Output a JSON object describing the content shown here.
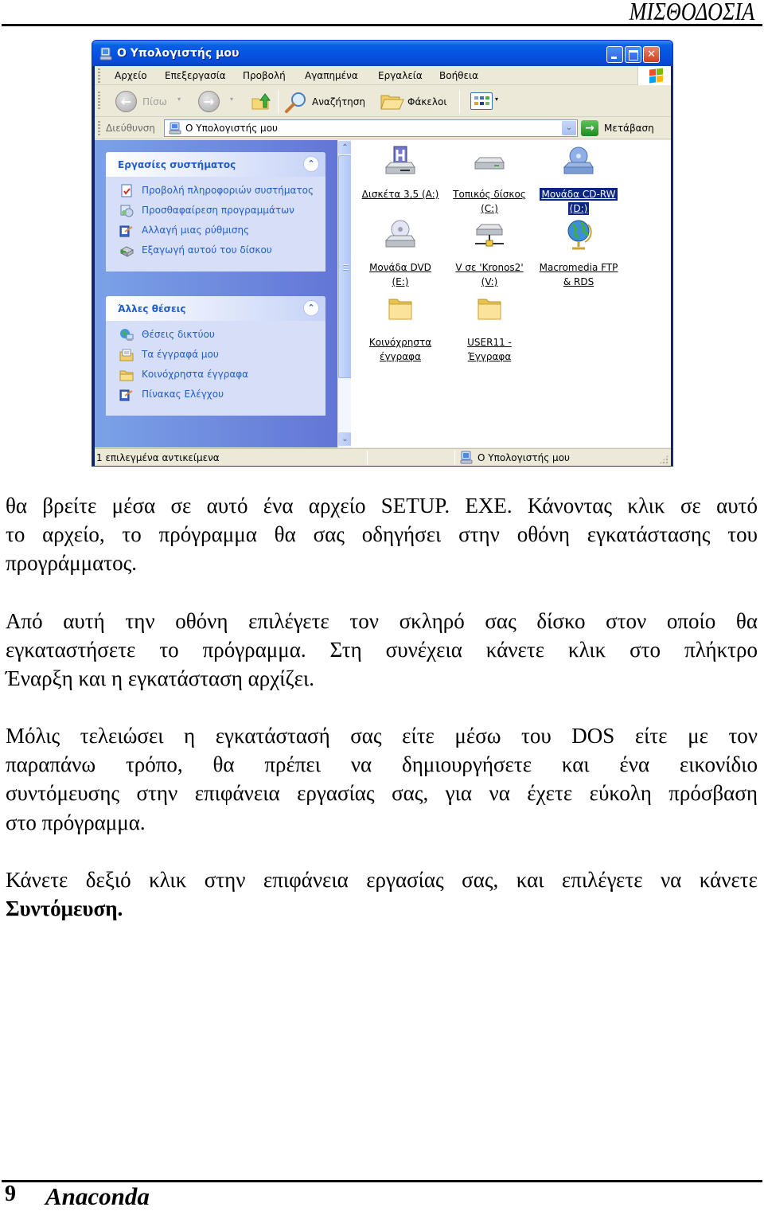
{
  "page_header": {
    "title": "ΜΙΣΘΟΔΟΣΙΑ"
  },
  "window": {
    "title": "Ο Υπολογιστής μου",
    "title_icon": "my-computer-icon",
    "controls": {
      "minimize": "minimize",
      "maximize": "maximize",
      "close": "✕"
    },
    "menu": [
      "Αρχείο",
      "Επεξεργασία",
      "Προβολή",
      "Αγαπημένα",
      "Εργαλεία",
      "Βοήθεια"
    ],
    "toolbar": {
      "back_label": "Πίσω",
      "search_label": "Αναζήτηση",
      "folders_label": "Φάκελοι",
      "back_arrow": "←",
      "forward_arrow": "→",
      "dropdown": "▾"
    },
    "address": {
      "label": "Διεύθυνση",
      "value": "Ο Υπολογιστής μου",
      "dropdown": "⌄",
      "go_arrow": "→",
      "go_label": "Μετάβαση"
    },
    "taskpane": {
      "system_tasks": {
        "title": "Εργασίες συστήματος",
        "collapse": "⌃",
        "items": [
          {
            "label": "Προβολή πληροφοριών συστήματος",
            "icon": "system-info-icon"
          },
          {
            "label": "Προσθαφαίρεση προγραμμάτων",
            "icon": "add-remove-programs-icon"
          },
          {
            "label": "Αλλαγή μιας ρύθμισης",
            "icon": "control-panel-icon"
          },
          {
            "label": "Εξαγωγή αυτού του δίσκου",
            "icon": "eject-disk-icon"
          }
        ]
      },
      "other_places": {
        "title": "Άλλες θέσεις",
        "collapse": "⌃",
        "items": [
          {
            "label": "Θέσεις δικτύου",
            "icon": "network-places-icon"
          },
          {
            "label": "Τα έγγραφά μου",
            "icon": "my-documents-icon"
          },
          {
            "label": "Κοινόχρηστα έγγραφα",
            "icon": "shared-documents-icon"
          },
          {
            "label": "Πίνακας Ελέγχου",
            "icon": "control-panel-icon"
          }
        ]
      }
    },
    "scrollbar": {
      "up": "⌃",
      "down": "⌄"
    },
    "items": [
      {
        "line1": "Δισκέτα 3,5 (A:)",
        "line2": "",
        "icon": "floppy-drive-icon",
        "selected": false
      },
      {
        "line1": "Τοπικός δίσκος",
        "line2": "(C:)",
        "icon": "hard-disk-icon",
        "selected": false
      },
      {
        "line1": "Μονάδα CD-RW",
        "line2": "(D:)",
        "icon": "cd-drive-icon",
        "selected": true
      },
      {
        "line1": "Μονάδα DVD",
        "line2": "(E:)",
        "icon": "dvd-drive-icon",
        "selected": false
      },
      {
        "line1": "V σε 'Kronos2'",
        "line2": "(V:)",
        "icon": "network-drive-icon",
        "selected": false
      },
      {
        "line1": "Macromedia FTP",
        "line2": "& RDS",
        "icon": "globe-icon",
        "selected": false
      },
      {
        "line1": "Κοινόχρηστα",
        "line2": "έγγραφα",
        "icon": "folder-icon",
        "selected": false
      },
      {
        "line1": "USER11 -",
        "line2": "Έγγραφα",
        "icon": "folder-icon",
        "selected": false
      }
    ],
    "status": {
      "left": "1 επιλεγμένα αντικείμενα",
      "right": "Ο Υπολογιστής μου"
    }
  },
  "paragraphs": [
    {
      "lines": [
        "θα βρείτε μέσα σε αυτό ένα αρχείο SETUP. EXE. Κάνοντας κλικ σε αυτό",
        "το αρχείο, το πρόγραμμα θα σας οδηγήσει στην οθόνη εγκατάστασης του",
        "προγράμματος."
      ]
    },
    {
      "lines": [
        "Από αυτή την οθόνη επιλέγετε τον σκληρό σας δίσκο στον οποίο θα",
        "εγκαταστήσετε το πρόγραμμα. Στη συνέχεια κάνετε κλικ στο πλήκτρο",
        "Έναρξη και η εγκατάσταση αρχίζει."
      ]
    },
    {
      "lines": [
        "Μόλις τελειώσει η εγκατάστασή σας είτε μέσω του DOS είτε με τον",
        "παραπάνω τρόπο, θα πρέπει να δημιουργήσετε και ένα εικονίδιο",
        "συντόμευσης στην επιφάνεια εργασίας σας, για να έχετε εύκολη πρόσβαση",
        "στο πρόγραμμα."
      ]
    },
    {
      "lines": [
        "Κάνετε δεξιό κλικ στην επιφάνεια εργασίας σας, και επιλέγετε να κάνετε"
      ],
      "bold_last_line": "Συντόμευση."
    }
  ],
  "page_footer": {
    "page_number": "9",
    "name": "Anaconda"
  }
}
